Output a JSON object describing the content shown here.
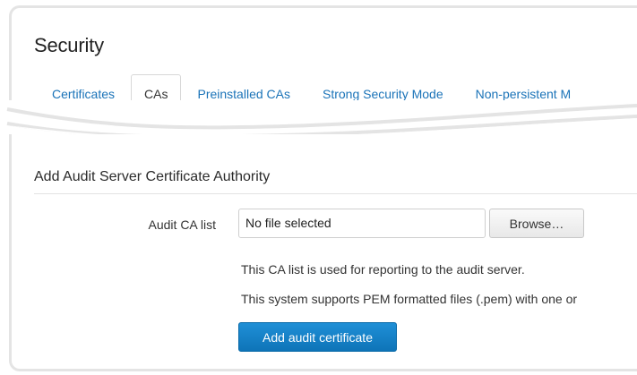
{
  "page": {
    "title": "Security"
  },
  "tabs": [
    {
      "label": "Certificates",
      "active": false
    },
    {
      "label": "CAs",
      "active": true
    },
    {
      "label": "Preinstalled CAs",
      "active": false
    },
    {
      "label": "Strong Security Mode",
      "active": false
    },
    {
      "label": "Non-persistent M",
      "active": false
    }
  ],
  "section": {
    "title": "Add Audit Server Certificate Authority"
  },
  "form": {
    "audit_ca_label": "Audit CA list",
    "file_value": "No file selected",
    "browse_label": "Browse…",
    "help_line_1": "This CA list is used for reporting to the audit server.",
    "help_line_2": "This system supports PEM formatted files (.pem) with one or",
    "submit_label": "Add audit certificate"
  },
  "colors": {
    "link": "#1a73b8",
    "primary": "#1584c8",
    "frame": "#e4e4e4"
  }
}
